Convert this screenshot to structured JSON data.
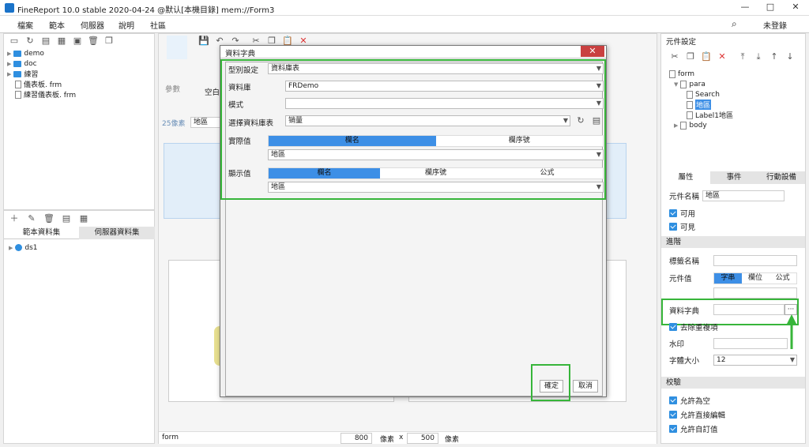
{
  "window": {
    "title": "FineReport 10.0 stable 2020-04-24 @默认[本機目錄]    mem://Form3",
    "min": "—",
    "max": "□",
    "close": "✕"
  },
  "menu": {
    "items": [
      "檔案",
      "範本",
      "伺服器",
      "說明",
      "社區"
    ],
    "login": "未登錄"
  },
  "left_tree": {
    "items": [
      {
        "label": "demo",
        "kind": "folder"
      },
      {
        "label": "doc",
        "kind": "folder"
      },
      {
        "label": "練習",
        "kind": "folder"
      },
      {
        "label": "儀表板. frm",
        "kind": "file"
      },
      {
        "label": "練習儀表板. frm",
        "kind": "file"
      }
    ]
  },
  "dataset_tabs": {
    "tab1": "範本資料集",
    "tab2": "伺服器資料集"
  },
  "datasets": {
    "item": "ds1"
  },
  "editor": {
    "label_param": "參數",
    "label_blank": "空白",
    "label_px": "25像素",
    "label_region": "地區"
  },
  "dialog": {
    "title": "資料字典",
    "type_label": "型別設定",
    "type_value": "資料庫表",
    "db_label": "資料庫",
    "db_value": "FRDemo",
    "mode_label": "模式",
    "mode_value": "",
    "table_label": "選擇資料庫表",
    "table_value": "销量",
    "actual_label": "實際值",
    "actual_tabs": [
      "欄名",
      "欄序號"
    ],
    "actual_value": "地區",
    "display_label": "顯示值",
    "display_tabs": [
      "欄名",
      "欄序號",
      "公式"
    ],
    "display_value": "地區",
    "ok": "確定",
    "cancel": "取消"
  },
  "status": {
    "name": "form",
    "width": "800",
    "unit1": "像素",
    "x": "x",
    "height": "500",
    "unit2": "像素"
  },
  "right_panel": {
    "header": "元件設定",
    "tree": [
      "form",
      "para",
      "Search",
      "地區",
      "Label1地區",
      "body"
    ],
    "tabs": [
      "屬性",
      "事件",
      "行動設備"
    ],
    "comp_name_label": "元件名稱",
    "comp_name_value": "地區",
    "enabled": "可用",
    "visible": "可見",
    "advanced": "進階",
    "tag_name": "標籤名稱",
    "comp_value": "元件值",
    "value_tabs": [
      "字串",
      "欄位",
      "公式"
    ],
    "dict_label": "資料字典",
    "dict_btn": "···",
    "remove_dup": "去除重複項",
    "watermark": "水印",
    "font_size_label": "字體大小",
    "font_size_value": "12",
    "validate": "校驗",
    "allow_empty": "允許為空",
    "allow_edit": "允許直接編輯",
    "allow_custom": "允許自訂值"
  }
}
